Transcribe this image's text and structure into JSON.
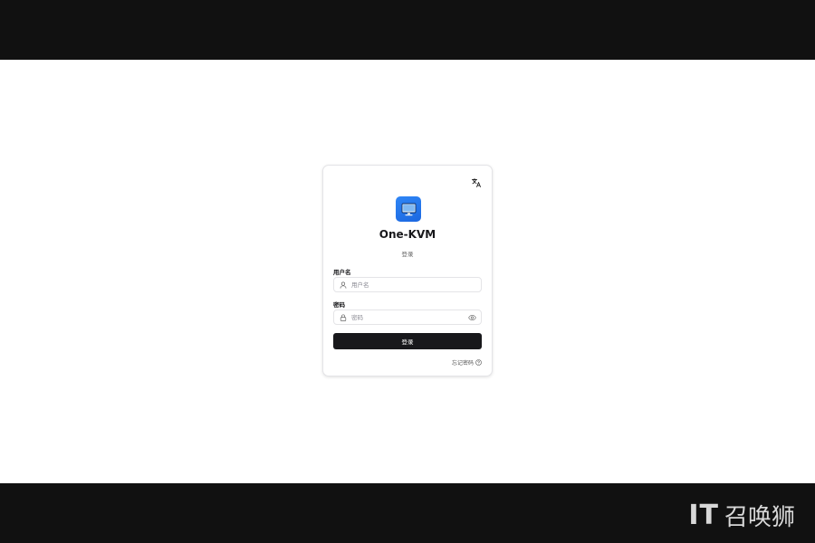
{
  "app": {
    "title": "One-KVM",
    "subtitle": "登录"
  },
  "form": {
    "username_label": "用户名",
    "username_placeholder": "用户名",
    "password_label": "密码",
    "password_placeholder": "密码",
    "login_label": "登录",
    "forgot_label": "忘记密码"
  },
  "icons": {
    "language": "language-icon",
    "logo": "monitor-icon",
    "user": "user-icon",
    "lock": "lock-icon",
    "eye": "eye-icon",
    "help": "help-circle-icon"
  },
  "colors": {
    "logo_blue": "#1b67e0",
    "button_dark": "#18181b",
    "frame_dark": "#111111"
  },
  "watermark": {
    "latin": "IT",
    "chinese": "召唤狮"
  }
}
